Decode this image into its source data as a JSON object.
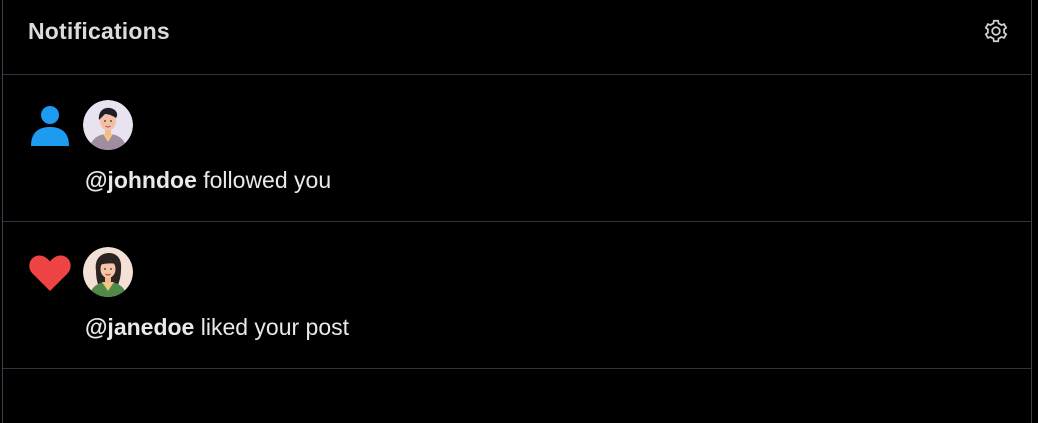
{
  "header": {
    "title": "Notifications",
    "settings_icon": "gear-icon"
  },
  "notifications": [
    {
      "type_icon": "person-icon",
      "type_color": "#1d9bf0",
      "handle": "@johndoe",
      "action": " followed you"
    },
    {
      "type_icon": "heart-icon",
      "type_color": "#ef4444",
      "handle": "@janedoe",
      "action": " liked your post"
    }
  ]
}
